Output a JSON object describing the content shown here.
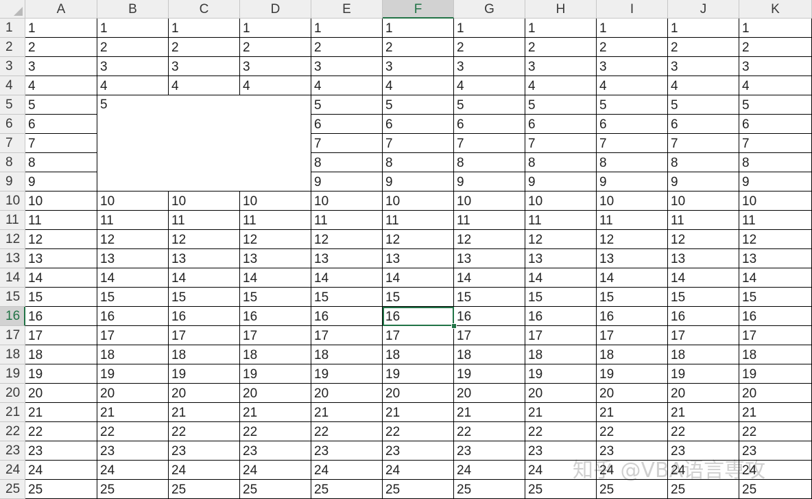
{
  "columns": [
    "A",
    "B",
    "C",
    "D",
    "E",
    "F",
    "G",
    "H",
    "I",
    "J",
    "K"
  ],
  "rows": [
    "1",
    "2",
    "3",
    "4",
    "5",
    "6",
    "7",
    "8",
    "9",
    "10",
    "11",
    "12",
    "13",
    "14",
    "15",
    "16",
    "17",
    "18",
    "19",
    "20",
    "21",
    "22",
    "23",
    "24",
    "25"
  ],
  "cells": [
    [
      "1",
      "1",
      "1",
      "1",
      "1",
      "1",
      "1",
      "1",
      "1",
      "1",
      "1"
    ],
    [
      "2",
      "2",
      "2",
      "2",
      "2",
      "2",
      "2",
      "2",
      "2",
      "2",
      "2"
    ],
    [
      "3",
      "3",
      "3",
      "3",
      "3",
      "3",
      "3",
      "3",
      "3",
      "3",
      "3"
    ],
    [
      "4",
      "4",
      "4",
      "4",
      "4",
      "4",
      "4",
      "4",
      "4",
      "4",
      "4"
    ],
    [
      "5",
      "5",
      "",
      "",
      "5",
      "5",
      "5",
      "5",
      "5",
      "5",
      "5"
    ],
    [
      "6",
      "",
      "",
      "",
      "6",
      "6",
      "6",
      "6",
      "6",
      "6",
      "6"
    ],
    [
      "7",
      "",
      "",
      "",
      "7",
      "7",
      "7",
      "7",
      "7",
      "7",
      "7"
    ],
    [
      "8",
      "",
      "",
      "",
      "8",
      "8",
      "8",
      "8",
      "8",
      "8",
      "8"
    ],
    [
      "9",
      "",
      "",
      "",
      "9",
      "9",
      "9",
      "9",
      "9",
      "9",
      "9"
    ],
    [
      "10",
      "10",
      "10",
      "10",
      "10",
      "10",
      "10",
      "10",
      "10",
      "10",
      "10"
    ],
    [
      "11",
      "11",
      "11",
      "11",
      "11",
      "11",
      "11",
      "11",
      "11",
      "11",
      "11"
    ],
    [
      "12",
      "12",
      "12",
      "12",
      "12",
      "12",
      "12",
      "12",
      "12",
      "12",
      "12"
    ],
    [
      "13",
      "13",
      "13",
      "13",
      "13",
      "13",
      "13",
      "13",
      "13",
      "13",
      "13"
    ],
    [
      "14",
      "14",
      "14",
      "14",
      "14",
      "14",
      "14",
      "14",
      "14",
      "14",
      "14"
    ],
    [
      "15",
      "15",
      "15",
      "15",
      "15",
      "15",
      "15",
      "15",
      "15",
      "15",
      "15"
    ],
    [
      "16",
      "16",
      "16",
      "16",
      "16",
      "16",
      "16",
      "16",
      "16",
      "16",
      "16"
    ],
    [
      "17",
      "17",
      "17",
      "17",
      "17",
      "17",
      "17",
      "17",
      "17",
      "17",
      "17"
    ],
    [
      "18",
      "18",
      "18",
      "18",
      "18",
      "18",
      "18",
      "18",
      "18",
      "18",
      "18"
    ],
    [
      "19",
      "19",
      "19",
      "19",
      "19",
      "19",
      "19",
      "19",
      "19",
      "19",
      "19"
    ],
    [
      "20",
      "20",
      "20",
      "20",
      "20",
      "20",
      "20",
      "20",
      "20",
      "20",
      "20"
    ],
    [
      "21",
      "21",
      "21",
      "21",
      "21",
      "21",
      "21",
      "21",
      "21",
      "21",
      "21"
    ],
    [
      "22",
      "22",
      "22",
      "22",
      "22",
      "22",
      "22",
      "22",
      "22",
      "22",
      "22"
    ],
    [
      "23",
      "23",
      "23",
      "23",
      "23",
      "23",
      "23",
      "23",
      "23",
      "23",
      "23"
    ],
    [
      "24",
      "24",
      "24",
      "24",
      "24",
      "24",
      "24",
      "24",
      "24",
      "24",
      "24"
    ],
    [
      "25",
      "25",
      "25",
      "25",
      "25",
      "25",
      "25",
      "25",
      "25",
      "25",
      "25"
    ]
  ],
  "merged_range": {
    "first_row": 5,
    "last_row": 9,
    "first_col": "B",
    "last_col": "D",
    "value": "5"
  },
  "active_cell": {
    "col": "F",
    "row": "16"
  },
  "watermark": "知乎 @VBA语言専攻",
  "colors": {
    "selection": "#217346",
    "header_bg": "#efefef",
    "header_selected_bg": "#d2d2d2",
    "gridline": "#000000"
  }
}
